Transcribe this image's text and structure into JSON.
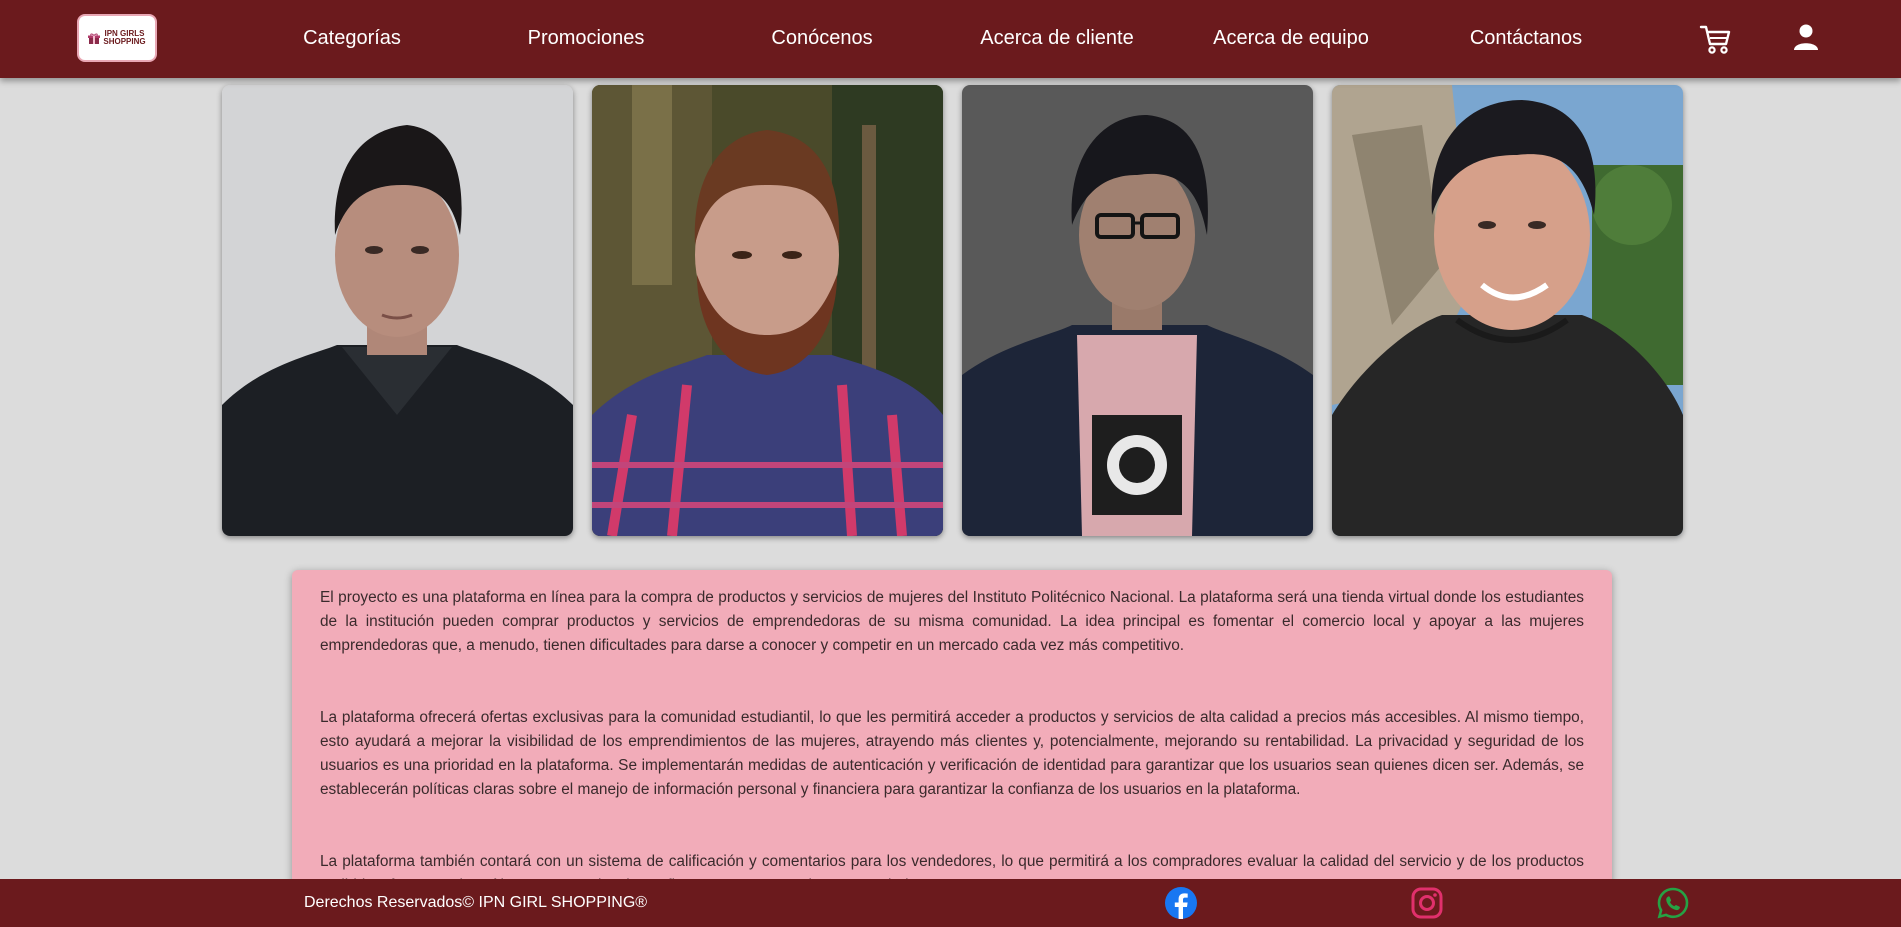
{
  "header": {
    "logo_text": "IPN GIRLS SHOPPING",
    "nav": [
      {
        "label": "Categorías"
      },
      {
        "label": "Promociones"
      },
      {
        "label": "Conócenos"
      },
      {
        "label": "Acerca de cliente"
      },
      {
        "label": "Acerca de equipo"
      },
      {
        "label": "Contáctanos"
      }
    ],
    "cart_icon": "cart-icon",
    "user_icon": "user-icon"
  },
  "team_photos": [
    {
      "icon": "team-member-photo-1"
    },
    {
      "icon": "team-member-photo-2"
    },
    {
      "icon": "team-member-photo-3"
    },
    {
      "icon": "team-member-photo-4"
    }
  ],
  "description": {
    "paragraphs": [
      "El proyecto es una plataforma en línea para la compra de productos y servicios de mujeres del Instituto Politécnico Nacional. La plataforma será una tienda virtual donde los estudiantes de la institución pueden comprar productos y servicios de emprendedoras de su misma comunidad. La idea principal es fomentar el comercio local y apoyar a las mujeres emprendedoras que, a menudo, tienen dificultades para darse a conocer y competir en un mercado cada vez más competitivo.",
      "La plataforma ofrecerá ofertas exclusivas para la comunidad estudiantil, lo que les permitirá acceder a productos y servicios de alta calidad a precios más accesibles. Al mismo tiempo, esto ayudará a mejorar la visibilidad de los emprendimientos de las mujeres, atrayendo más clientes y, potencialmente, mejorando su rentabilidad. La privacidad y seguridad de los usuarios es una prioridad en la plataforma. Se implementarán medidas de autenticación y verificación de identidad para garantizar que los usuarios sean quienes dicen ser. Además, se establecerán políticas claras sobre el manejo de información personal y financiera para garantizar la confianza de los usuarios en la plataforma.",
      "La plataforma también contará con un sistema de calificación y comentarios para los vendedores, lo que permitirá a los compradores evaluar la calidad del servicio y de los productos recibidos, fomentando así la transparencia y la confianza entre compradores y vendedoras."
    ]
  },
  "footer": {
    "copyright": "Derechos Reservados© IPN GIRL SHOPPING®",
    "social": [
      {
        "icon": "facebook-icon",
        "color": "#1877f2"
      },
      {
        "icon": "instagram-icon",
        "color": "#e1306c"
      },
      {
        "icon": "whatsapp-icon",
        "color": "#25a244"
      }
    ]
  },
  "colors": {
    "header_bg": "#6b1a1d",
    "page_bg": "#dcdcdc",
    "card_bg": "#f2acb9"
  }
}
